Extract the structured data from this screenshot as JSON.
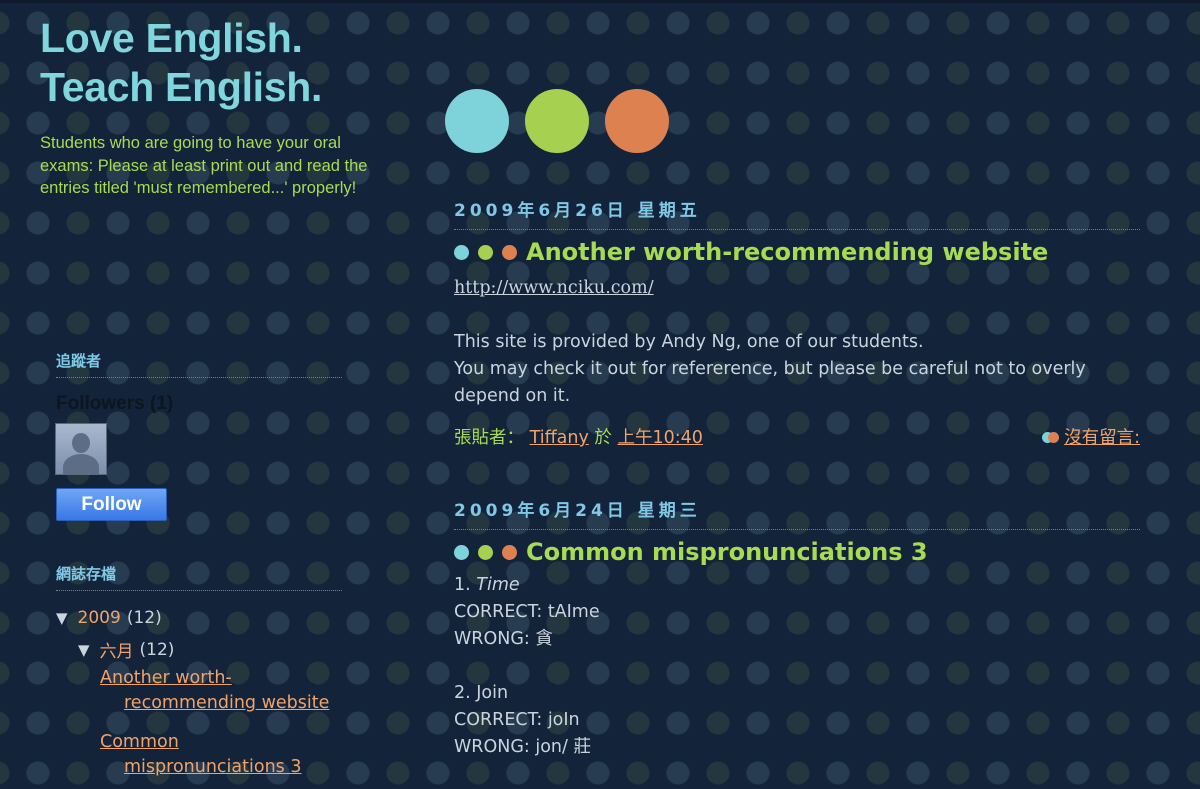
{
  "blog": {
    "title_line1": "Love English.",
    "title_line2": "Teach English.",
    "description": "Students who are going to have your oral exams: Please at least print out and read the entries titled 'must remembered...' properly!"
  },
  "colors": {
    "teal": "#7dd3d9",
    "green": "#a6d04f",
    "orange": "#de8150",
    "background": "#13233a"
  },
  "sidebar": {
    "followers_heading": "追蹤者",
    "followers_count": "Followers (1)",
    "follow_label": "Follow",
    "archive_heading": "網誌存檔",
    "archive": {
      "year": "2009",
      "year_count": "(12)",
      "month": "六月",
      "month_count": "(12)",
      "toggle": "▼",
      "posts": [
        {
          "line1": "Another worth-",
          "line2": "recommending website"
        },
        {
          "line1": "Common",
          "line2": "mispronunciations 3"
        }
      ]
    }
  },
  "posts": [
    {
      "date": "2009年6月26日 星期五",
      "title": "Another worth-recommending website",
      "url": "http://www.nciku.com/",
      "body": [
        "This site is provided by Andy Ng, one of our students.",
        "You may check it out for refererence, but please be careful not to overly depend on it."
      ],
      "footer": {
        "posted_by": "張貼者：",
        "author": "Tiffany",
        "at": "於",
        "time": "上午10:40",
        "comments": "沒有留言:"
      }
    },
    {
      "date": "2009年6月24日 星期三",
      "title": "Common mispronunciations 3",
      "items": [
        {
          "num": "1. ",
          "word": "Time",
          "correct": "CORRECT: tAIme",
          "wrong": "WRONG: 貪"
        },
        {
          "num": "2. ",
          "word": "Join",
          "correct": "CORRECT: joIn",
          "wrong": "WRONG: jon/ 莊"
        }
      ]
    }
  ]
}
